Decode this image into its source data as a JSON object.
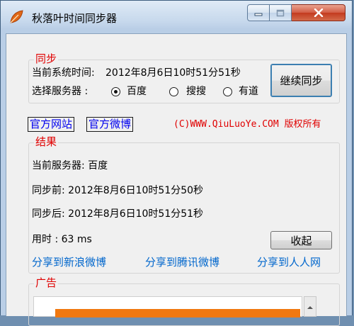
{
  "window": {
    "title": "秋落叶时间同步器",
    "controls": {
      "minimize_icon": "minimize-icon",
      "maximize_icon": "maximize-icon",
      "close_icon": "close-icon"
    }
  },
  "sync": {
    "group_label": "同步",
    "system_time_label": "当前系统时间:",
    "system_time_value": "2012年8月6日10时51分51秒",
    "server_label": "选择服务器  :",
    "servers": [
      "百度",
      "搜搜",
      "有道"
    ],
    "selected_server": "百度",
    "button_label": "继续同步"
  },
  "links": {
    "official_site": "官方网站",
    "official_weibo": "官方微博",
    "copyright": "(C)WWW.QiuLuoYe.COM 版权所有"
  },
  "result": {
    "group_label": "结果",
    "current_server": "当前服务器: 百度",
    "before": "同步前: 2012年8月6日10时51分50秒",
    "after": "同步后: 2012年8月6日10时51分51秒",
    "elapsed": "用时  : 63 ms",
    "collapse_button": "收起",
    "share_sina": "分享到新浪微博",
    "share_tencent": "分享到腾讯微博",
    "share_renren": "分享到人人网"
  },
  "ad": {
    "group_label": "广告"
  },
  "colors": {
    "accent_red": "#e00000",
    "link_blue": "#0066cc",
    "banner_orange": "#f07810"
  }
}
